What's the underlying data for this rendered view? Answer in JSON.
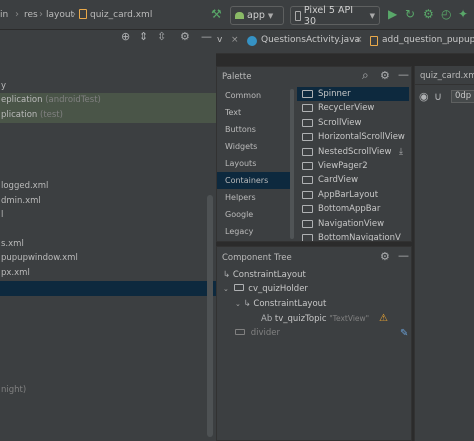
{
  "breadcrumb": {
    "items": [
      "in",
      "res",
      "layout",
      "quiz_card.xml"
    ]
  },
  "toolbar": {
    "run_config": "app",
    "device": "Pixel 5 API 30"
  },
  "project_tree": {
    "rows": [
      {
        "text": "",
        "style": "normal"
      },
      {
        "text": "y",
        "style": "normal"
      },
      {
        "text": "eplication",
        "suffix": "(androidTest)",
        "style": "green"
      },
      {
        "text": "plication",
        "suffix": "(test)",
        "style": "green"
      },
      {
        "text": "logged.xml",
        "style": "normal"
      },
      {
        "text": "dmin.xml",
        "style": "normal"
      },
      {
        "text": "l",
        "style": "normal"
      },
      {
        "text": "s.xml",
        "style": "normal"
      },
      {
        "text": "pupupwindow.xml",
        "style": "normal"
      },
      {
        "text": "px.xml",
        "style": "normal"
      },
      {
        "text": "night)",
        "style": "gray"
      }
    ]
  },
  "editor_tabs": [
    {
      "label": "QuestionsActivity.java"
    },
    {
      "label": "add_question_pupupwin"
    }
  ],
  "palette": {
    "title": "Palette",
    "categories": [
      "Common",
      "Text",
      "Buttons",
      "Widgets",
      "Layouts",
      "Containers",
      "Helpers",
      "Google",
      "Legacy"
    ],
    "selected_category": "Containers",
    "items": [
      "Spinner",
      "RecyclerView",
      "ScrollView",
      "HorizontalScrollView",
      "NestedScrollView",
      "ViewPager2",
      "CardView",
      "AppBarLayout",
      "BottomAppBar",
      "NavigationView",
      "BottomNavigationV"
    ]
  },
  "component_tree": {
    "title": "Component Tree",
    "nodes": [
      {
        "label": "ConstraintLayout"
      },
      {
        "label": "cv_quizHolder"
      },
      {
        "label": "ConstraintLayout"
      },
      {
        "label": "tv_quizTopic",
        "hint": "\"TextView\"",
        "prefix": "Ab"
      },
      {
        "label": "divider"
      }
    ]
  },
  "attributes": {
    "file_label": "quiz_card.xml",
    "dp_value": "0dp"
  },
  "colors": {
    "warning": "#f0a732",
    "selection": "#0d293e",
    "green_highlight": "#4a5548"
  }
}
